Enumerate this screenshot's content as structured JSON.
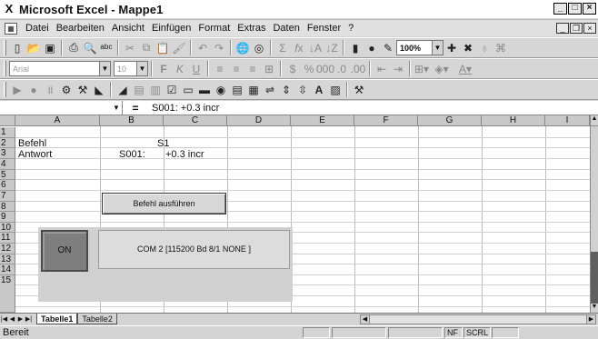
{
  "window": {
    "title": "Microsoft Excel - Mappe1",
    "app_icon": "X"
  },
  "menu": {
    "items": [
      "Datei",
      "Bearbeiten",
      "Ansicht",
      "Einfügen",
      "Format",
      "Extras",
      "Daten",
      "Fenster",
      "?"
    ]
  },
  "toolbar_standard": {
    "zoom": "100%"
  },
  "toolbar_format": {
    "font": "Arial",
    "size": "10",
    "bold": "F",
    "italic": "K",
    "underline": "U"
  },
  "formula_bar": {
    "equals": "=",
    "content": "S001:    +0.3  incr"
  },
  "columns": [
    "A",
    "B",
    "C",
    "D",
    "E",
    "F",
    "G",
    "H",
    "I"
  ],
  "rows": [
    "1",
    "2",
    "3",
    "4",
    "5",
    "6",
    "7",
    "8",
    "9",
    "10",
    "11",
    "12",
    "13",
    "14",
    "15"
  ],
  "cells": {
    "a2": "Befehl",
    "c2": "S1",
    "a3": "Antwort",
    "b3": "S001:",
    "c3": "+0.3  incr"
  },
  "controls": {
    "execute_button": "Befehl ausführen",
    "on_button": "ON",
    "com_label": "COM 2 [115200 Bd 8/1 NONE ]"
  },
  "sheets": {
    "tab1": "Tabelle1",
    "tab2": "Tabelle2"
  },
  "status": {
    "text": "Bereit",
    "nf": "NF",
    "scrl": "SCRL"
  }
}
